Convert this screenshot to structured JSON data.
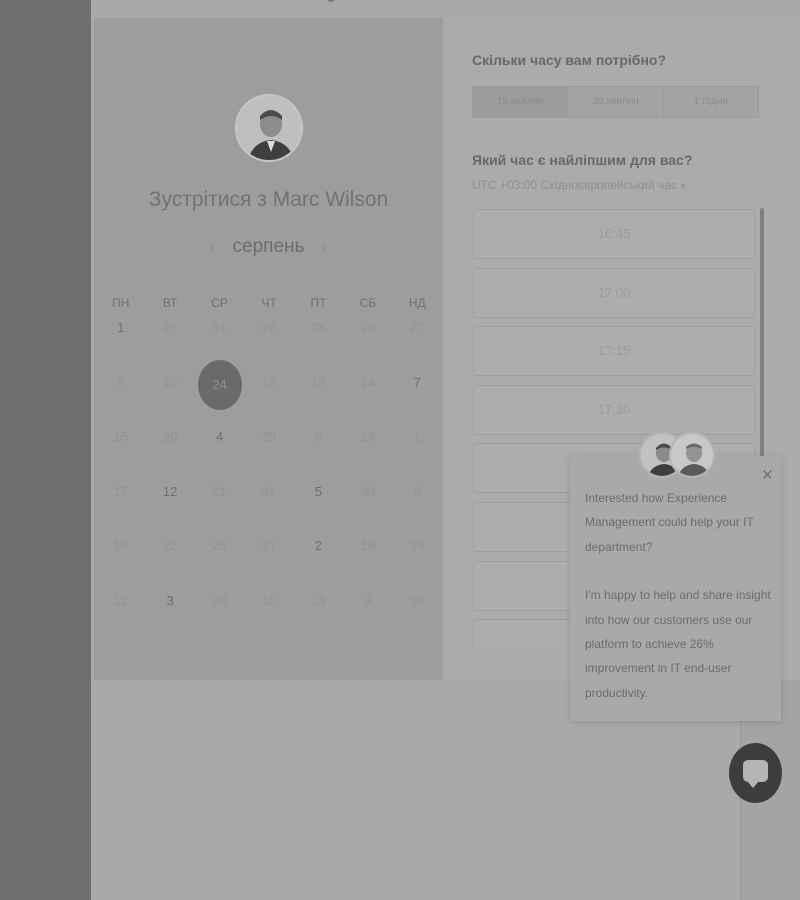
{
  "scheduler": {
    "title": "Зустрітися з Marc Wilson",
    "month": "серпень",
    "prev_glyph": "‹",
    "next_glyph": "›",
    "weekdays": [
      "ПН",
      "ВТ",
      "СР",
      "ЧТ",
      "ПТ",
      "СБ",
      "НД"
    ],
    "calendar_rows": [
      [
        "1",
        "25",
        "31",
        "26",
        "28",
        "20",
        "27"
      ],
      [
        "8",
        "10",
        "24",
        "18",
        "17",
        "14",
        "7"
      ],
      [
        "15",
        "20",
        "4",
        "29",
        "8",
        "13",
        "1"
      ],
      [
        "17",
        "12",
        "21",
        "31",
        "5",
        "30",
        "9"
      ],
      [
        "19",
        "22",
        "28",
        "27",
        "2",
        "16",
        "24"
      ],
      [
        "12",
        "3",
        "30",
        "10",
        "14",
        "9",
        "10"
      ]
    ],
    "selected_day": "24",
    "duration_question": "Скільки часу вам потрібно?",
    "durations": [
      "15 хвилин",
      "30 хвилин",
      "1 годин"
    ],
    "active_duration": "15 хвилин",
    "time_question": "Який час є найліпшим для вас?",
    "timezone": "UTC +03:00 Східноєвропейський час",
    "timezone_caret": "▾",
    "time_slots": [
      "16:45",
      "17:00",
      "17:15",
      "17:30",
      "",
      "",
      "",
      ""
    ]
  },
  "chat": {
    "close_glyph": "×",
    "message_1": "Interested how Experience Management could help your IT department?",
    "message_2": "I'm happy to help and share insight into how our customers use our platform to achieve 26% improvement in IT end-user productivity."
  }
}
